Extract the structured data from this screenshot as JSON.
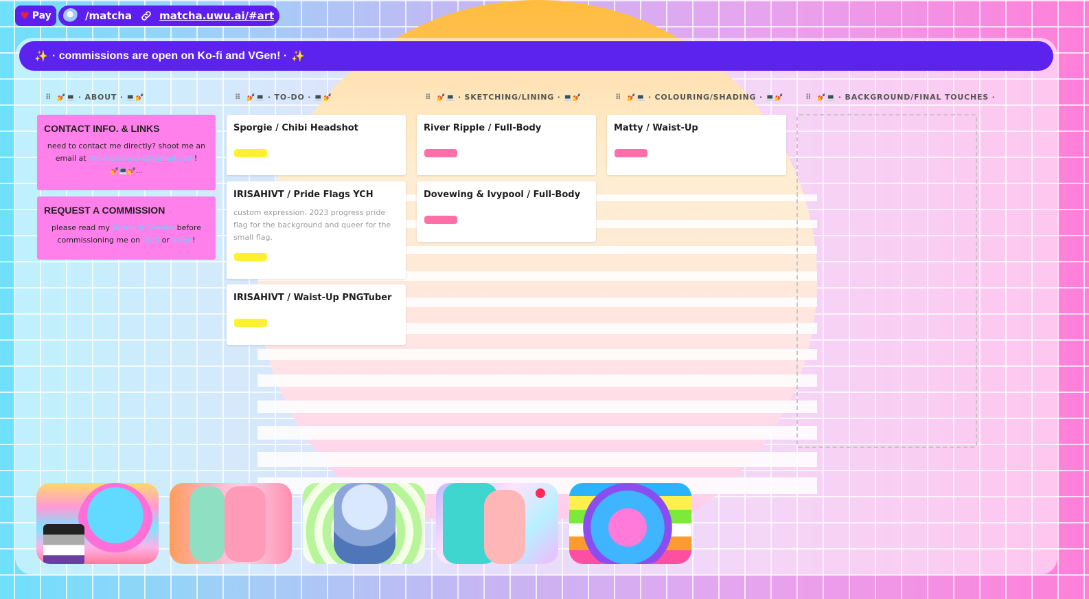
{
  "topbar": {
    "pay_label": "Pay",
    "path": "/matcha",
    "url": "matcha.uwu.ai/#art"
  },
  "banner": {
    "sparkle": "✨",
    "text": "· commissions are open on Ko-fi and VGen! ·"
  },
  "columns": [
    {
      "drag": "⠿",
      "deco": "💅💻",
      "label": "· ABOUT ·",
      "deco_end": "💻💅"
    },
    {
      "drag": "⠿",
      "deco": "💅💻",
      "label": "· TO-DO ·",
      "deco_end": "💻💅"
    },
    {
      "drag": "⠿",
      "deco": "💅💻",
      "label": "· SKETCHING/LINING ·",
      "deco_end": "💻💅"
    },
    {
      "drag": "⠿",
      "deco": "💅💻",
      "label": "· COLOURING/SHADING ·",
      "deco_end": "💻💅"
    },
    {
      "drag": "⠿",
      "deco": "💅💻",
      "label": "· BACKGROUND/FINAL TOUCHES ·",
      "deco_end": ""
    }
  ],
  "about": {
    "contact": {
      "title": "CONTACT INFO. & LINKS",
      "text_before": "need to contact me directly? shoot me an email at ",
      "email": "mx.matcha.exe@gmail.com",
      "text_after": "!",
      "deco": "💅💻💅..."
    },
    "commission": {
      "title": "REQUEST A COMMISSION",
      "t1": "please read my ",
      "tos": "Terms of Service",
      "t2": " before commissioning me on ",
      "kofi": "Ko-fi",
      "t3": " or ",
      "vgen": "VGen",
      "t4": "!"
    }
  },
  "todo": [
    {
      "title": "Sporgie / Chibi Headshot",
      "tag": "yellow"
    },
    {
      "title": "IRISAHIVT / Pride Flags YCH",
      "desc": "custom expression. 2023 progress pride flag for the background and queer for the small flag.",
      "tag": "yellow"
    },
    {
      "title": "IRISAHIVT / Waist-Up PNGTuber",
      "tag": "yellow"
    }
  ],
  "sketching": [
    {
      "title": "River Ripple / Full-Body",
      "tag": "pink"
    },
    {
      "title": "Dovewing & Ivypool / Full-Body",
      "tag": "pink"
    }
  ],
  "colouring": [
    {
      "title": "Matty / Waist-Up",
      "tag": "pink"
    }
  ],
  "gallery": [
    {
      "name": "gallery-thumb-1"
    },
    {
      "name": "gallery-thumb-2"
    },
    {
      "name": "gallery-thumb-3"
    },
    {
      "name": "gallery-thumb-4"
    },
    {
      "name": "gallery-thumb-5"
    }
  ],
  "colors": {
    "accent": "#5c22ee",
    "about_card": "#ff80ea",
    "tag_yellow": "#fff033",
    "tag_pink": "#ff6fa8",
    "link": "#73c8ff"
  }
}
